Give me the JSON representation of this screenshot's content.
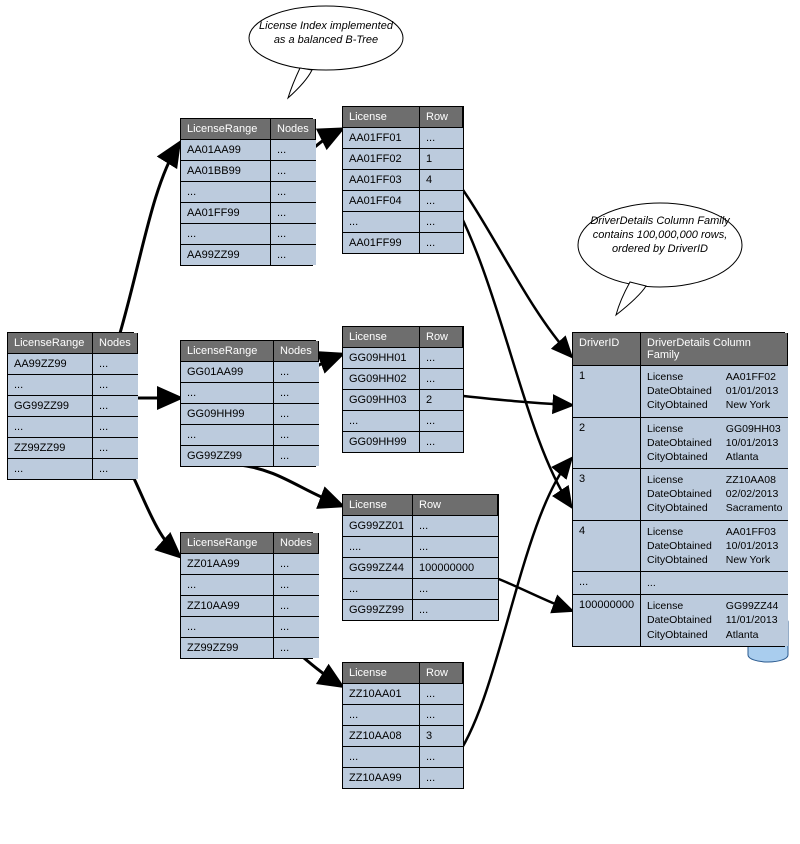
{
  "callouts": {
    "btree": "License Index implemented as a balanced B-Tree",
    "driver": "DriverDetails Column Family contains 100,000,000 rows, ordered by DriverID"
  },
  "root": {
    "headers": [
      "LicenseRange",
      "Nodes"
    ],
    "rows": [
      [
        "AA99ZZ99",
        "..."
      ],
      [
        "...",
        "..."
      ],
      [
        "GG99ZZ99",
        "..."
      ],
      [
        "...",
        "..."
      ],
      [
        "ZZ99ZZ99",
        "..."
      ],
      [
        "...",
        "..."
      ]
    ]
  },
  "nodeA": {
    "headers": [
      "LicenseRange",
      "Nodes"
    ],
    "rows": [
      [
        "AA01AA99",
        "..."
      ],
      [
        "AA01BB99",
        "..."
      ],
      [
        "...",
        "..."
      ],
      [
        "AA01FF99",
        "..."
      ],
      [
        "...",
        "..."
      ],
      [
        "AA99ZZ99",
        "..."
      ]
    ]
  },
  "nodeB": {
    "headers": [
      "LicenseRange",
      "Nodes"
    ],
    "rows": [
      [
        "GG01AA99",
        "..."
      ],
      [
        "...",
        "..."
      ],
      [
        "GG09HH99",
        "..."
      ],
      [
        "...",
        "..."
      ],
      [
        "GG99ZZ99",
        "..."
      ]
    ]
  },
  "nodeC": {
    "headers": [
      "LicenseRange",
      "Nodes"
    ],
    "rows": [
      [
        "ZZ01AA99",
        "..."
      ],
      [
        "...",
        "..."
      ],
      [
        "ZZ10AA99",
        "..."
      ],
      [
        "...",
        "..."
      ],
      [
        "ZZ99ZZ99",
        "..."
      ]
    ]
  },
  "leafA": {
    "headers": [
      "License",
      "Row"
    ],
    "rows": [
      [
        "AA01FF01",
        "..."
      ],
      [
        "AA01FF02",
        "1"
      ],
      [
        "AA01FF03",
        "4"
      ],
      [
        "AA01FF04",
        "..."
      ],
      [
        "...",
        "..."
      ],
      [
        "AA01FF99",
        "..."
      ]
    ]
  },
  "leafB": {
    "headers": [
      "License",
      "Row"
    ],
    "rows": [
      [
        "GG09HH01",
        "..."
      ],
      [
        "GG09HH02",
        "..."
      ],
      [
        "GG09HH03",
        "2"
      ],
      [
        "...",
        "..."
      ],
      [
        "GG09HH99",
        "..."
      ]
    ]
  },
  "leafC": {
    "headers": [
      "License",
      "Row"
    ],
    "rows": [
      [
        "GG99ZZ01",
        "..."
      ],
      [
        "....",
        "..."
      ],
      [
        "GG99ZZ44",
        "100000000"
      ],
      [
        "...",
        "..."
      ],
      [
        "GG99ZZ99",
        "..."
      ]
    ]
  },
  "leafD": {
    "headers": [
      "License",
      "Row"
    ],
    "rows": [
      [
        "ZZ10AA01",
        "..."
      ],
      [
        "...",
        "..."
      ],
      [
        "ZZ10AA08",
        "3"
      ],
      [
        "...",
        "..."
      ],
      [
        "ZZ10AA99",
        "..."
      ]
    ]
  },
  "details": {
    "headers": [
      "DriverID",
      "DriverDetails Column Family"
    ],
    "rows": [
      {
        "id": "1",
        "fields": [
          [
            "License",
            "AA01FF02"
          ],
          [
            "DateObtained",
            "01/01/2013"
          ],
          [
            "CityObtained",
            "New York"
          ]
        ]
      },
      {
        "id": "2",
        "fields": [
          [
            "License",
            "GG09HH03"
          ],
          [
            "DateObtained",
            "10/01/2013"
          ],
          [
            "CityObtained",
            "Atlanta"
          ]
        ]
      },
      {
        "id": "3",
        "fields": [
          [
            "License",
            "ZZ10AA08"
          ],
          [
            "DateObtained",
            "02/02/2013"
          ],
          [
            "CityObtained",
            "Sacramento"
          ]
        ]
      },
      {
        "id": "4",
        "fields": [
          [
            "License",
            "AA01FF03"
          ],
          [
            "DateObtained",
            "10/01/2013"
          ],
          [
            "CityObtained",
            "New York"
          ]
        ]
      },
      {
        "id": "...",
        "fields": [
          [
            "...",
            ""
          ]
        ]
      },
      {
        "id": "100000000",
        "fields": [
          [
            "License",
            "GG99ZZ44"
          ],
          [
            "DateObtained",
            "11/01/2013"
          ],
          [
            "CityObtained",
            "Atlanta"
          ]
        ]
      }
    ]
  }
}
